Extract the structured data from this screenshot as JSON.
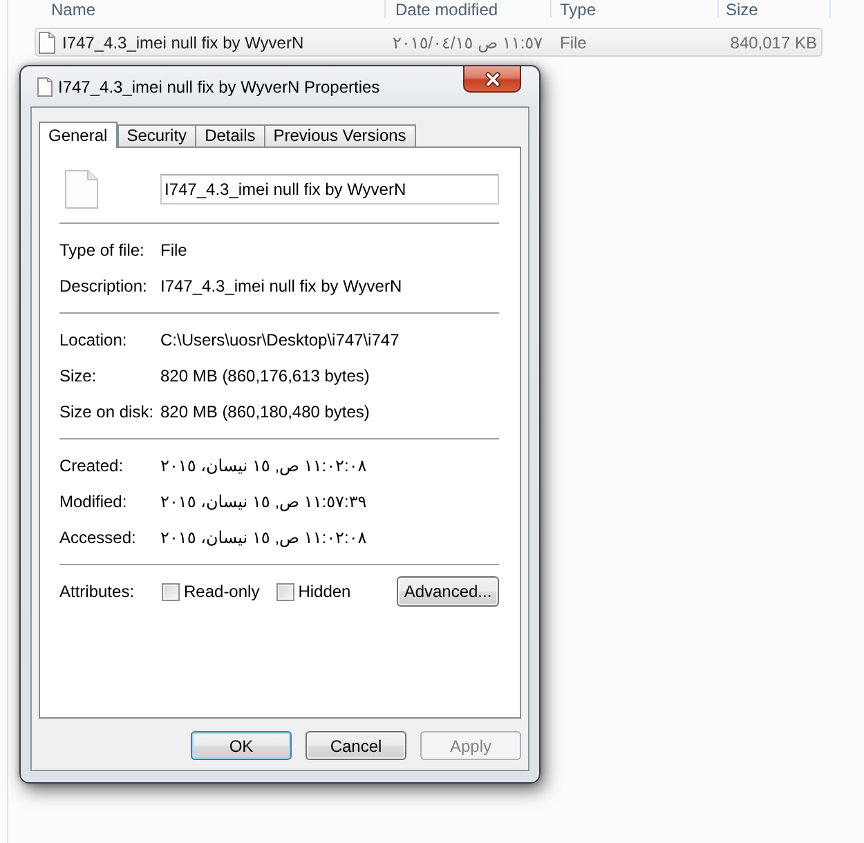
{
  "explorer": {
    "columns": [
      "Name",
      "Date modified",
      "Type",
      "Size"
    ],
    "rows": [
      {
        "name": "I747_4.3_imei null fix by WyverN",
        "date_modified": "١١:٥٧ ص ٢٠١٥/٠٤/١٥",
        "type": "File",
        "size": "840,017 KB",
        "selected": true
      }
    ]
  },
  "dialog": {
    "title": "I747_4.3_imei null fix by WyverN Properties",
    "tabs": [
      {
        "label": "General",
        "selected": true
      },
      {
        "label": "Security",
        "selected": false
      },
      {
        "label": "Details",
        "selected": false
      },
      {
        "label": "Previous Versions",
        "selected": false
      }
    ],
    "file_name": "I747_4.3_imei null fix by WyverN",
    "sections": [
      [
        {
          "label": "Type of file:",
          "value": "File"
        },
        {
          "label": "Description:",
          "value": "I747_4.3_imei null fix by WyverN"
        }
      ],
      [
        {
          "label": "Location:",
          "value": "C:\\Users\\uosr\\Desktop\\i747\\i747"
        },
        {
          "label": "Size:",
          "value": "820 MB (860,176,613 bytes)"
        },
        {
          "label": "Size on disk:",
          "value": "820 MB (860,180,480 bytes)"
        }
      ],
      [
        {
          "label": "Created:",
          "value": "١١:٠٢:٠٨ ص, ١٥ نيسان، ٢٠١٥"
        },
        {
          "label": "Modified:",
          "value": "١١:٥٧:٣٩ ص, ١٥ نيسان، ٢٠١٥"
        },
        {
          "label": "Accessed:",
          "value": "١١:٠٢:٠٨ ص, ١٥ نيسان، ٢٠١٥"
        }
      ]
    ],
    "attributes": {
      "label": "Attributes:",
      "checkboxes": [
        {
          "label": "Read-only",
          "checked": false
        },
        {
          "label": "Hidden",
          "checked": false
        }
      ],
      "advanced_button": "Advanced..."
    },
    "buttons": [
      {
        "label": "OK",
        "default": true,
        "disabled": false
      },
      {
        "label": "Cancel",
        "default": false,
        "disabled": false
      },
      {
        "label": "Apply",
        "default": false,
        "disabled": true
      }
    ]
  }
}
